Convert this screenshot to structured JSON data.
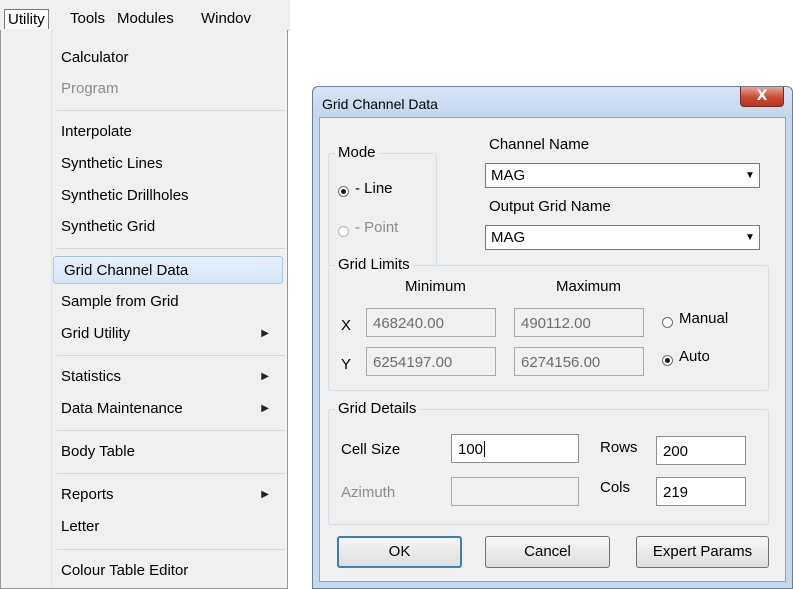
{
  "menubar": {
    "items": [
      "Utility",
      "Tools",
      "Modules",
      "Windov"
    ]
  },
  "menu": {
    "items": [
      {
        "label": "Calculator"
      },
      {
        "label": "Program"
      },
      {
        "label": "Interpolate"
      },
      {
        "label": "Synthetic Lines"
      },
      {
        "label": "Synthetic Drillholes"
      },
      {
        "label": "Synthetic Grid"
      },
      {
        "label": "Grid Channel Data"
      },
      {
        "label": "Sample from Grid"
      },
      {
        "label": "Grid Utility"
      },
      {
        "label": "Statistics"
      },
      {
        "label": "Data Maintenance"
      },
      {
        "label": "Body Table"
      },
      {
        "label": "Reports"
      },
      {
        "label": "Letter"
      },
      {
        "label": "Colour Table Editor"
      }
    ],
    "submenu_glyph": "▶"
  },
  "dialog": {
    "title": "Grid Channel Data",
    "close_glyph": "X",
    "mode": {
      "legend": "Mode",
      "line_label": "- Line",
      "point_label": "- Point",
      "selected": "Line"
    },
    "channel_name": {
      "label": "Channel Name",
      "value": "MAG"
    },
    "output_grid_name": {
      "label": "Output Grid Name",
      "value": "MAG"
    },
    "combo_arrow": "▼",
    "grid_limits": {
      "legend": "Grid Limits",
      "minimum_header": "Minimum",
      "maximum_header": "Maximum",
      "x_label": "X",
      "y_label": "Y",
      "x_min": "468240.00",
      "x_max": "490112.00",
      "y_min": "6254197.00",
      "y_max": "6274156.00",
      "manual_label": "Manual",
      "auto_label": "Auto",
      "selected": "Auto"
    },
    "grid_details": {
      "legend": "Grid Details",
      "cell_size_label": "Cell Size",
      "cell_size_value": "100",
      "azimuth_label": "Azimuth",
      "azimuth_value": "",
      "rows_label": "Rows",
      "rows_value": "200",
      "cols_label": "Cols",
      "cols_value": "219"
    },
    "buttons": {
      "ok": "OK",
      "cancel": "Cancel",
      "expert": "Expert Params"
    }
  }
}
